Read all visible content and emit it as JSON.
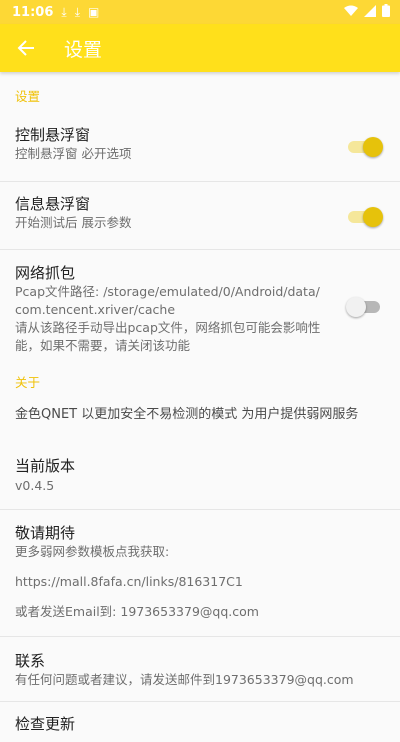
{
  "status": {
    "time": "11:06"
  },
  "appbar": {
    "title": "设置"
  },
  "sections": {
    "settings_header": "设置",
    "about_header": "关于"
  },
  "settings": [
    {
      "title": "控制悬浮窗",
      "summary": "控制悬浮窗 必开选项",
      "switch": true
    },
    {
      "title": "信息悬浮窗",
      "summary": "开始测试后 展示参数",
      "switch": true
    },
    {
      "title": "网络抓包",
      "summary_lines": [
        "Pcap文件路径: /storage/emulated/0/Android/data/",
        "com.tencent.xriver/cache",
        "请从该路径手动导出pcap文件，网络抓包可能会影响性",
        "能，如果不需要，请关闭该功能"
      ],
      "switch": false
    }
  ],
  "about": {
    "description": "金色QNET 以更加安全不易检测的模式 为用户提供弱网服务",
    "version_title": "当前版本",
    "version_value": "v0.4.5",
    "coming_title": "敬请期待",
    "coming_line1": "更多弱网参数模板点我获取:",
    "coming_link": "https://mall.8fafa.cn/links/816317C1",
    "coming_email": " 或者发送Email到: 1973653379@qq.com",
    "contact_title": "联系",
    "contact_summary": "有任何问题或者建议，请发送邮件到1973653379@qq.com",
    "update_title": "检查更新"
  },
  "colors": {
    "accent": "#ffe01b",
    "category": "#f0c20a",
    "switch_on": "#e6c20b"
  }
}
